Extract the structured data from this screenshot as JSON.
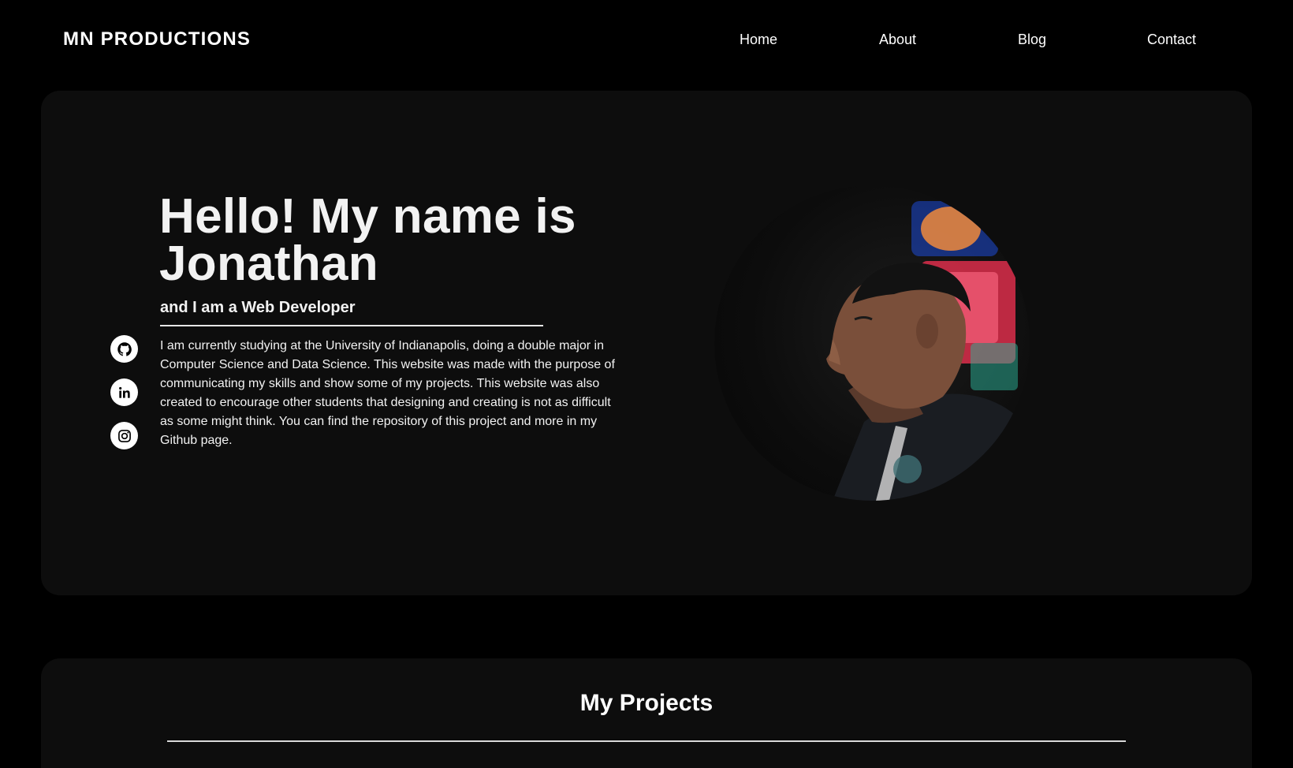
{
  "header": {
    "brand": "MN PRODUCTIONS",
    "nav": {
      "home": "Home",
      "about": "About",
      "blog": "Blog",
      "contact": "Contact"
    }
  },
  "hero": {
    "title": "Hello! My name is Jonathan",
    "subtitle": "and I am a Web Developer",
    "bio": "I am currently studying at the University of Indianapolis, doing a double major in Computer Science and Data Science. This website was made with the purpose of communicating my skills and show some of my projects. This website was also created to encourage other students that designing and creating is not as difficult as some might think. You can find the repository of this project and more in my Github page.",
    "socials": [
      {
        "icon": "github-icon"
      },
      {
        "icon": "linkedin-icon"
      },
      {
        "icon": "instagram-icon"
      }
    ],
    "portrait": {
      "subject": "profile-photo"
    }
  },
  "projects": {
    "title": "My Projects"
  },
  "colors": {
    "background": "#000000",
    "card": "#0d0d0d",
    "text": "#ffffff",
    "divider": "#e6e6e6"
  }
}
